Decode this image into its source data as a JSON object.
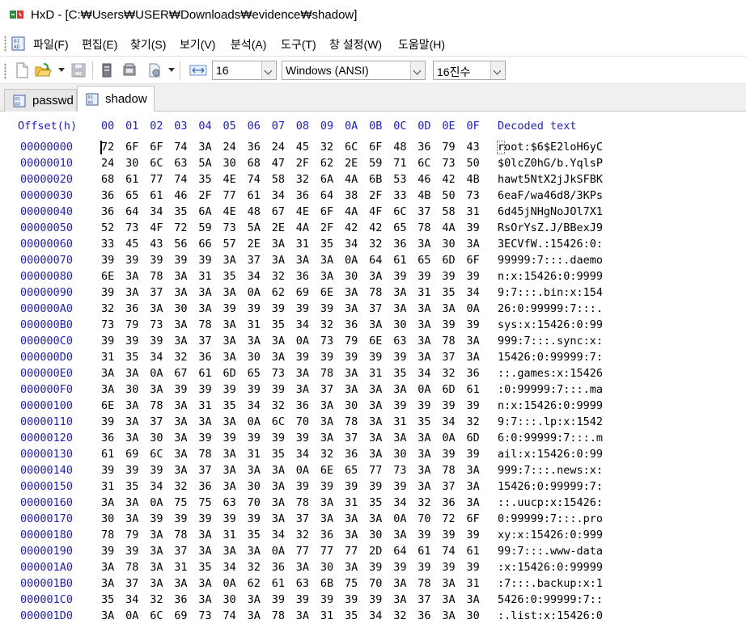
{
  "window": {
    "title": "HxD - [C:₩Users₩USER₩Downloads₩evidence₩shadow]"
  },
  "menu": {
    "items": [
      "파일(F)",
      "편집(E)",
      "찾기(S)",
      "보기(V)",
      "분석(A)",
      "도구(T)",
      "창 설정(W)",
      "도움말(H)"
    ]
  },
  "toolbar": {
    "bytes_per_row": "16",
    "charset": "Windows (ANSI)",
    "offset_base": "16진수"
  },
  "tabs": [
    {
      "label": "passwd",
      "active": false
    },
    {
      "label": "shadow",
      "active": true
    }
  ],
  "editor": {
    "offset_header": "Offset(h)",
    "columns": [
      "00",
      "01",
      "02",
      "03",
      "04",
      "05",
      "06",
      "07",
      "08",
      "09",
      "0A",
      "0B",
      "0C",
      "0D",
      "0E",
      "0F"
    ],
    "decoded_header": "Decoded text",
    "rows": [
      {
        "offset": "00000000",
        "bytes": [
          "72",
          "6F",
          "6F",
          "74",
          "3A",
          "24",
          "36",
          "24",
          "45",
          "32",
          "6C",
          "6F",
          "48",
          "36",
          "79",
          "43"
        ],
        "text": "root:$6$E2loH6yC"
      },
      {
        "offset": "00000010",
        "bytes": [
          "24",
          "30",
          "6C",
          "63",
          "5A",
          "30",
          "68",
          "47",
          "2F",
          "62",
          "2E",
          "59",
          "71",
          "6C",
          "73",
          "50"
        ],
        "text": "$0lcZ0hG/b.YqlsP"
      },
      {
        "offset": "00000020",
        "bytes": [
          "68",
          "61",
          "77",
          "74",
          "35",
          "4E",
          "74",
          "58",
          "32",
          "6A",
          "4A",
          "6B",
          "53",
          "46",
          "42",
          "4B"
        ],
        "text": "hawt5NtX2jJkSFBK"
      },
      {
        "offset": "00000030",
        "bytes": [
          "36",
          "65",
          "61",
          "46",
          "2F",
          "77",
          "61",
          "34",
          "36",
          "64",
          "38",
          "2F",
          "33",
          "4B",
          "50",
          "73"
        ],
        "text": "6eaF/wa46d8/3KPs"
      },
      {
        "offset": "00000040",
        "bytes": [
          "36",
          "64",
          "34",
          "35",
          "6A",
          "4E",
          "48",
          "67",
          "4E",
          "6F",
          "4A",
          "4F",
          "6C",
          "37",
          "58",
          "31"
        ],
        "text": "6d45jNHgNoJOl7X1"
      },
      {
        "offset": "00000050",
        "bytes": [
          "52",
          "73",
          "4F",
          "72",
          "59",
          "73",
          "5A",
          "2E",
          "4A",
          "2F",
          "42",
          "42",
          "65",
          "78",
          "4A",
          "39"
        ],
        "text": "RsOrYsZ.J/BBexJ9"
      },
      {
        "offset": "00000060",
        "bytes": [
          "33",
          "45",
          "43",
          "56",
          "66",
          "57",
          "2E",
          "3A",
          "31",
          "35",
          "34",
          "32",
          "36",
          "3A",
          "30",
          "3A"
        ],
        "text": "3ECVfW.:15426:0:"
      },
      {
        "offset": "00000070",
        "bytes": [
          "39",
          "39",
          "39",
          "39",
          "39",
          "3A",
          "37",
          "3A",
          "3A",
          "3A",
          "0A",
          "64",
          "61",
          "65",
          "6D",
          "6F"
        ],
        "text": "99999:7:::.daemo"
      },
      {
        "offset": "00000080",
        "bytes": [
          "6E",
          "3A",
          "78",
          "3A",
          "31",
          "35",
          "34",
          "32",
          "36",
          "3A",
          "30",
          "3A",
          "39",
          "39",
          "39",
          "39"
        ],
        "text": "n:x:15426:0:9999"
      },
      {
        "offset": "00000090",
        "bytes": [
          "39",
          "3A",
          "37",
          "3A",
          "3A",
          "3A",
          "0A",
          "62",
          "69",
          "6E",
          "3A",
          "78",
          "3A",
          "31",
          "35",
          "34"
        ],
        "text": "9:7:::.bin:x:154"
      },
      {
        "offset": "000000A0",
        "bytes": [
          "32",
          "36",
          "3A",
          "30",
          "3A",
          "39",
          "39",
          "39",
          "39",
          "39",
          "3A",
          "37",
          "3A",
          "3A",
          "3A",
          "0A"
        ],
        "text": "26:0:99999:7:::."
      },
      {
        "offset": "000000B0",
        "bytes": [
          "73",
          "79",
          "73",
          "3A",
          "78",
          "3A",
          "31",
          "35",
          "34",
          "32",
          "36",
          "3A",
          "30",
          "3A",
          "39",
          "39"
        ],
        "text": "sys:x:15426:0:99"
      },
      {
        "offset": "000000C0",
        "bytes": [
          "39",
          "39",
          "39",
          "3A",
          "37",
          "3A",
          "3A",
          "3A",
          "0A",
          "73",
          "79",
          "6E",
          "63",
          "3A",
          "78",
          "3A"
        ],
        "text": "999:7:::.sync:x:"
      },
      {
        "offset": "000000D0",
        "bytes": [
          "31",
          "35",
          "34",
          "32",
          "36",
          "3A",
          "30",
          "3A",
          "39",
          "39",
          "39",
          "39",
          "39",
          "3A",
          "37",
          "3A"
        ],
        "text": "15426:0:99999:7:"
      },
      {
        "offset": "000000E0",
        "bytes": [
          "3A",
          "3A",
          "0A",
          "67",
          "61",
          "6D",
          "65",
          "73",
          "3A",
          "78",
          "3A",
          "31",
          "35",
          "34",
          "32",
          "36"
        ],
        "text": "::.games:x:15426"
      },
      {
        "offset": "000000F0",
        "bytes": [
          "3A",
          "30",
          "3A",
          "39",
          "39",
          "39",
          "39",
          "39",
          "3A",
          "37",
          "3A",
          "3A",
          "3A",
          "0A",
          "6D",
          "61"
        ],
        "text": ":0:99999:7:::.ma"
      },
      {
        "offset": "00000100",
        "bytes": [
          "6E",
          "3A",
          "78",
          "3A",
          "31",
          "35",
          "34",
          "32",
          "36",
          "3A",
          "30",
          "3A",
          "39",
          "39",
          "39",
          "39"
        ],
        "text": "n:x:15426:0:9999"
      },
      {
        "offset": "00000110",
        "bytes": [
          "39",
          "3A",
          "37",
          "3A",
          "3A",
          "3A",
          "0A",
          "6C",
          "70",
          "3A",
          "78",
          "3A",
          "31",
          "35",
          "34",
          "32"
        ],
        "text": "9:7:::.lp:x:1542"
      },
      {
        "offset": "00000120",
        "bytes": [
          "36",
          "3A",
          "30",
          "3A",
          "39",
          "39",
          "39",
          "39",
          "39",
          "3A",
          "37",
          "3A",
          "3A",
          "3A",
          "0A",
          "6D"
        ],
        "text": "6:0:99999:7:::.m"
      },
      {
        "offset": "00000130",
        "bytes": [
          "61",
          "69",
          "6C",
          "3A",
          "78",
          "3A",
          "31",
          "35",
          "34",
          "32",
          "36",
          "3A",
          "30",
          "3A",
          "39",
          "39"
        ],
        "text": "ail:x:15426:0:99"
      },
      {
        "offset": "00000140",
        "bytes": [
          "39",
          "39",
          "39",
          "3A",
          "37",
          "3A",
          "3A",
          "3A",
          "0A",
          "6E",
          "65",
          "77",
          "73",
          "3A",
          "78",
          "3A"
        ],
        "text": "999:7:::.news:x:"
      },
      {
        "offset": "00000150",
        "bytes": [
          "31",
          "35",
          "34",
          "32",
          "36",
          "3A",
          "30",
          "3A",
          "39",
          "39",
          "39",
          "39",
          "39",
          "3A",
          "37",
          "3A"
        ],
        "text": "15426:0:99999:7:"
      },
      {
        "offset": "00000160",
        "bytes": [
          "3A",
          "3A",
          "0A",
          "75",
          "75",
          "63",
          "70",
          "3A",
          "78",
          "3A",
          "31",
          "35",
          "34",
          "32",
          "36",
          "3A"
        ],
        "text": "::.uucp:x:15426:"
      },
      {
        "offset": "00000170",
        "bytes": [
          "30",
          "3A",
          "39",
          "39",
          "39",
          "39",
          "39",
          "3A",
          "37",
          "3A",
          "3A",
          "3A",
          "0A",
          "70",
          "72",
          "6F"
        ],
        "text": "0:99999:7:::.pro"
      },
      {
        "offset": "00000180",
        "bytes": [
          "78",
          "79",
          "3A",
          "78",
          "3A",
          "31",
          "35",
          "34",
          "32",
          "36",
          "3A",
          "30",
          "3A",
          "39",
          "39",
          "39"
        ],
        "text": "xy:x:15426:0:999"
      },
      {
        "offset": "00000190",
        "bytes": [
          "39",
          "39",
          "3A",
          "37",
          "3A",
          "3A",
          "3A",
          "0A",
          "77",
          "77",
          "77",
          "2D",
          "64",
          "61",
          "74",
          "61"
        ],
        "text": "99:7:::.www-data"
      },
      {
        "offset": "000001A0",
        "bytes": [
          "3A",
          "78",
          "3A",
          "31",
          "35",
          "34",
          "32",
          "36",
          "3A",
          "30",
          "3A",
          "39",
          "39",
          "39",
          "39",
          "39"
        ],
        "text": ":x:15426:0:99999"
      },
      {
        "offset": "000001B0",
        "bytes": [
          "3A",
          "37",
          "3A",
          "3A",
          "3A",
          "0A",
          "62",
          "61",
          "63",
          "6B",
          "75",
          "70",
          "3A",
          "78",
          "3A",
          "31"
        ],
        "text": ":7:::.backup:x:1"
      },
      {
        "offset": "000001C0",
        "bytes": [
          "35",
          "34",
          "32",
          "36",
          "3A",
          "30",
          "3A",
          "39",
          "39",
          "39",
          "39",
          "39",
          "3A",
          "37",
          "3A",
          "3A"
        ],
        "text": "5426:0:99999:7::"
      },
      {
        "offset": "000001D0",
        "bytes": [
          "3A",
          "0A",
          "6C",
          "69",
          "73",
          "74",
          "3A",
          "78",
          "3A",
          "31",
          "35",
          "34",
          "32",
          "36",
          "3A",
          "30"
        ],
        "text": ":.list:x:15426:0"
      }
    ]
  },
  "colors": {
    "offset": "#2020c0",
    "text": "#000000"
  }
}
